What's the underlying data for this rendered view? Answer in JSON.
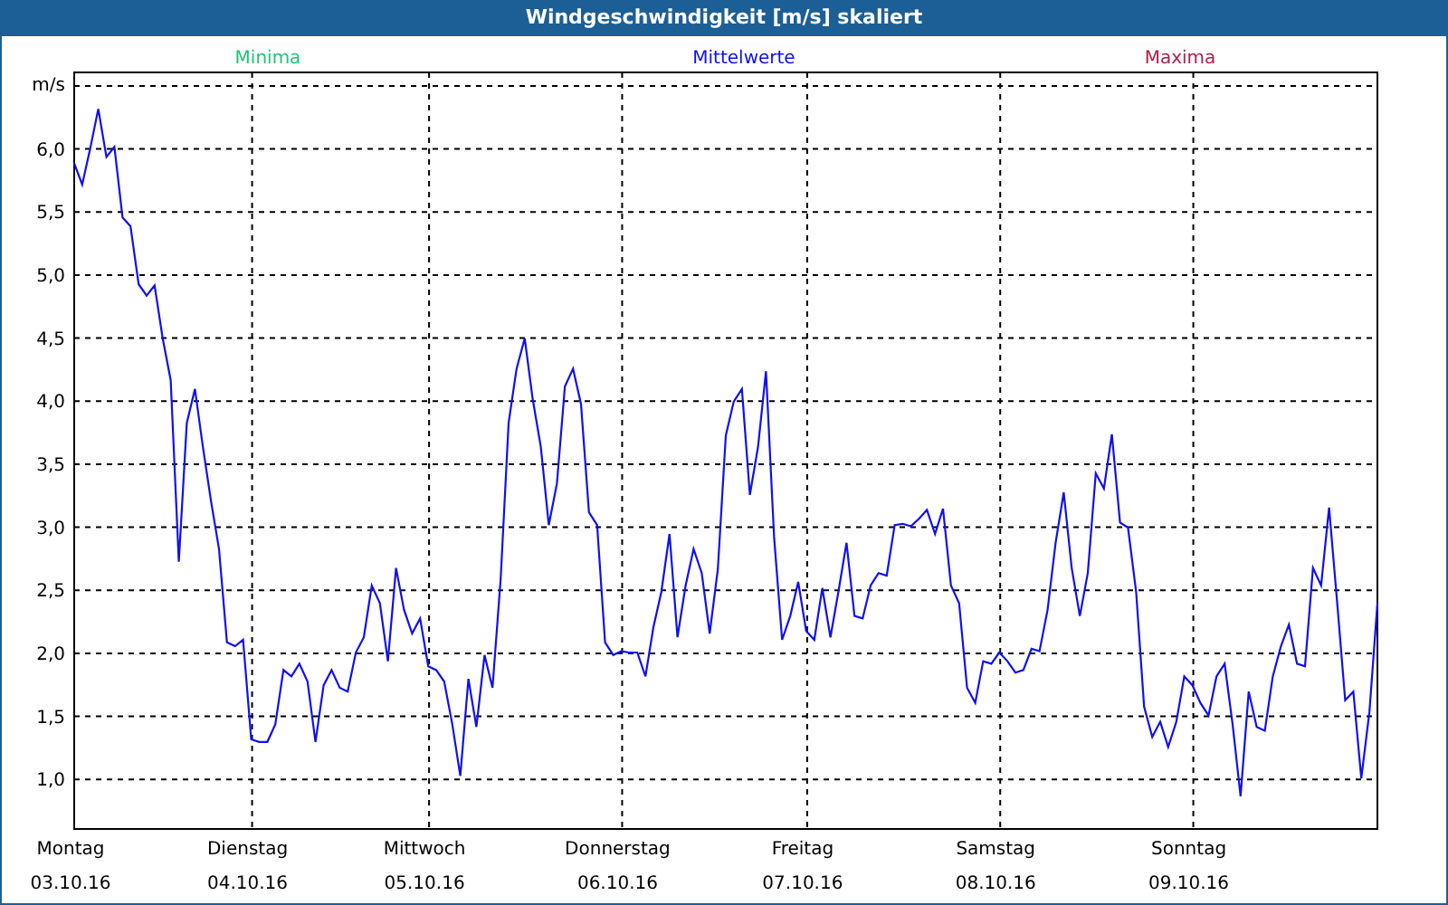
{
  "window": {
    "title": "Windgeschwindigkeit [m/s] skaliert"
  },
  "legend": [
    {
      "label": "Minima",
      "color": "#22c47a"
    },
    {
      "label": "Maxima",
      "color": "#b0204a"
    }
  ],
  "chart": {
    "chart_data": {
      "type": "line",
      "grid": true,
      "ylabel": "m/s",
      "ylim": [
        0.6,
        6.6
      ],
      "categories": [
        "Montag",
        null,
        null,
        null,
        null,
        null,
        null,
        null,
        null,
        null,
        null,
        null,
        null,
        null,
        null,
        null,
        null,
        null,
        null,
        null,
        null,
        null,
        "Dienstag",
        null,
        null,
        null,
        null,
        null,
        null,
        null,
        null,
        null,
        null,
        null,
        null,
        null,
        null,
        null,
        null,
        null,
        null,
        null,
        null,
        null,
        "Mittwoch",
        null,
        null,
        null,
        null,
        null,
        null,
        null,
        null,
        null,
        null,
        null,
        null,
        null,
        null,
        null,
        null,
        null,
        null,
        null,
        null,
        null,
        null,
        null,
        "Donnerstag",
        null,
        null,
        null,
        null,
        null,
        null,
        null,
        null,
        null,
        null,
        null,
        null,
        null,
        null,
        null,
        null,
        null,
        null,
        null,
        null,
        null,
        null,
        "Freitag",
        null,
        null,
        null,
        null,
        null,
        null,
        null,
        null,
        null,
        null,
        null,
        null,
        null,
        null,
        null,
        null,
        null,
        null,
        null,
        null,
        null,
        null,
        null,
        "Samstag",
        null,
        null,
        null,
        null,
        null,
        null,
        null,
        null,
        null,
        null,
        null,
        null,
        null,
        null,
        null,
        null,
        null,
        null,
        null,
        null,
        null,
        null,
        null,
        "Sonntag",
        null,
        null,
        null,
        null,
        null,
        null,
        null,
        null,
        null,
        null,
        null,
        null,
        null,
        null,
        null,
        null,
        null,
        null,
        null,
        null,
        null,
        null,
        null
      ],
      "yticks": [
        {
          "value": 1,
          "label": "1,0"
        },
        {
          "value": 1.5,
          "label": "1,5"
        },
        {
          "value": 2,
          "label": "2,0"
        },
        {
          "value": 2.5,
          "label": "2,5"
        },
        {
          "value": 3,
          "label": "3,0"
        },
        {
          "value": 3.5,
          "label": "3,5"
        },
        {
          "value": 4,
          "label": "4,0"
        },
        {
          "value": 4.5,
          "label": "4,5"
        },
        {
          "value": 5,
          "label": "5,0"
        },
        {
          "value": 5.5,
          "label": "5,5"
        },
        {
          "value": 6,
          "label": "6,0"
        }
      ],
      "series": [
        {
          "name": "Mittelwerte",
          "color": "#1010f0",
          "values": [
            5.88,
            5.71,
            6.0,
            6.31,
            5.93,
            6.01,
            5.45,
            5.38,
            4.92,
            4.83,
            4.91,
            4.49,
            4.16,
            2.72,
            3.82,
            4.09,
            3.63,
            3.2,
            2.82,
            2.08,
            2.05,
            2.1,
            1.31,
            1.29,
            1.29,
            1.43,
            1.86,
            1.81,
            1.91,
            1.77,
            1.29,
            1.74,
            1.86,
            1.72,
            1.69,
            2.0,
            2.12,
            2.53,
            2.39,
            1.93,
            2.67,
            2.34,
            2.15,
            2.27,
            1.89,
            1.86,
            1.77,
            1.43,
            1.02,
            1.79,
            1.41,
            1.98,
            1.72,
            2.58,
            3.82,
            4.25,
            4.49,
            4.01,
            3.63,
            3.01,
            3.34,
            4.11,
            4.25,
            3.97,
            3.11,
            3.01,
            2.08,
            1.98,
            2.01,
            2.0,
            2.0,
            1.81,
            2.2,
            2.48,
            2.94,
            2.12,
            2.53,
            2.82,
            2.63,
            2.15,
            2.66,
            3.72,
            3.99,
            4.09,
            3.25,
            3.63,
            4.23,
            2.91,
            2.1,
            2.29,
            2.56,
            2.17,
            2.1,
            2.51,
            2.12,
            2.48,
            2.87,
            2.29,
            2.27,
            2.53,
            2.63,
            2.61,
            3.01,
            3.02,
            3.0,
            3.06,
            3.13,
            2.94,
            3.14,
            2.53,
            2.39,
            1.72,
            1.6,
            1.93,
            1.91,
            2.0,
            1.93,
            1.84,
            1.86,
            2.03,
            2.01,
            2.34,
            2.87,
            3.27,
            2.67,
            2.29,
            2.63,
            3.42,
            3.3,
            3.73,
            3.03,
            2.99,
            2.48,
            1.57,
            1.33,
            1.45,
            1.25,
            1.45,
            1.81,
            1.74,
            1.6,
            1.5,
            1.81,
            1.91,
            1.43,
            0.86,
            1.69,
            1.41,
            1.38,
            1.81,
            2.05,
            2.22,
            1.91,
            1.89,
            2.67,
            2.53,
            3.15,
            2.39,
            1.62,
            1.69,
            1.0,
            1.53,
            2.39
          ]
        }
      ]
    },
    "dates": [
      "03.10.16",
      "04.10.16",
      "05.10.16",
      "06.10.16",
      "07.10.16",
      "08.10.16",
      "09.10.16"
    ]
  }
}
